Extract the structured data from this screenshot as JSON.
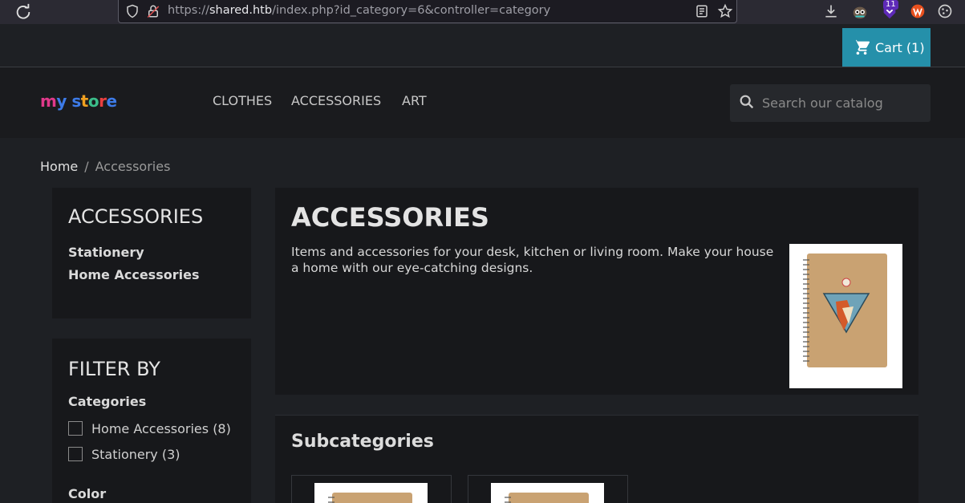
{
  "browser": {
    "url_prefix": "https://",
    "url_host": "shared.htb",
    "url_path": "/index.php?id_category=6&controller=category",
    "extension_badge": "11"
  },
  "header": {
    "cart_label": "Cart (1)",
    "logo_text": "my store",
    "menu": [
      {
        "label": "CLOTHES"
      },
      {
        "label": "ACCESSORIES"
      },
      {
        "label": "ART"
      }
    ],
    "search_placeholder": "Search our catalog"
  },
  "breadcrumb": {
    "home": "Home",
    "separator": "/",
    "current": "Accessories"
  },
  "sidebar": {
    "category_title": "ACCESSORIES",
    "subcategories": [
      {
        "label": "Stationery"
      },
      {
        "label": "Home Accessories"
      }
    ],
    "filter_title": "FILTER BY",
    "facets": {
      "categories_title": "Categories",
      "categories": [
        {
          "label": "Home Accessories (8)",
          "checked": false
        },
        {
          "label": "Stationery (3)",
          "checked": false
        }
      ],
      "color_title": "Color"
    }
  },
  "category": {
    "title": "ACCESSORIES",
    "description": "Items and accessories for your desk, kitchen or living room. Make your house a home with our eye-catching designs.",
    "subcategories_title": "Subcategories"
  },
  "colors": {
    "cart_bg": "#2590aa",
    "page_bg": "#1e2024",
    "block_bg": "#17181b"
  }
}
